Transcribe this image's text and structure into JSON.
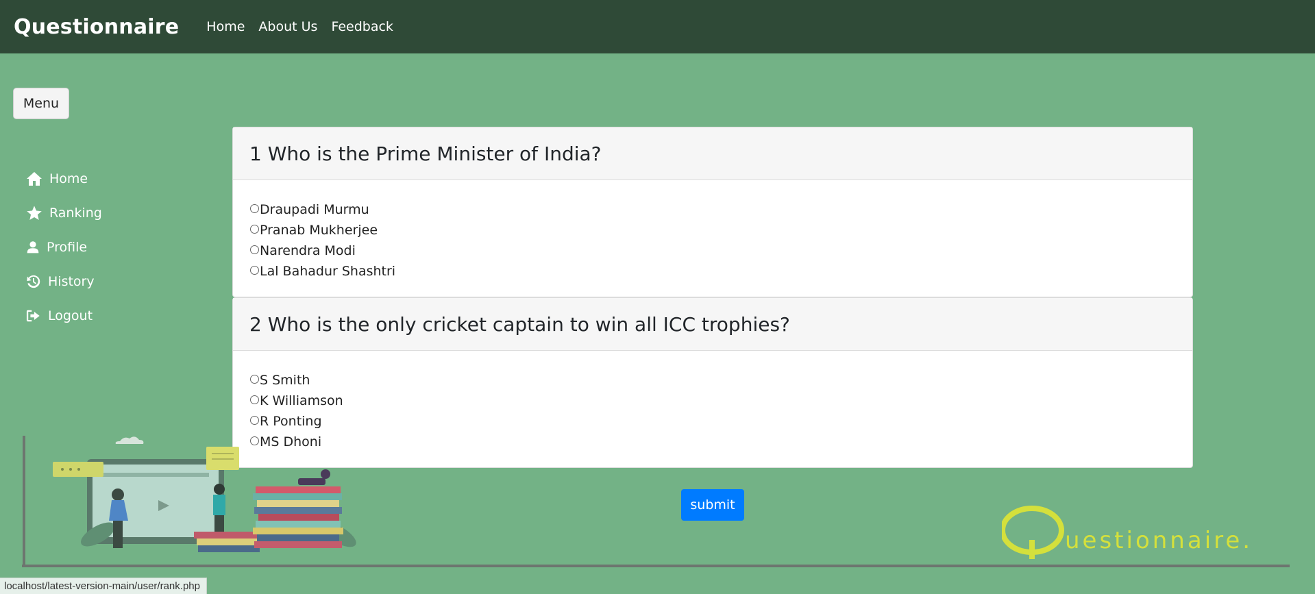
{
  "header": {
    "brand": "Questionnaire",
    "nav": [
      "Home",
      "About Us",
      "Feedback"
    ]
  },
  "menu_button": "Menu",
  "sidebar": {
    "items": [
      {
        "label": "Home",
        "icon": "home-icon"
      },
      {
        "label": "Ranking",
        "icon": "star-icon"
      },
      {
        "label": "Profile",
        "icon": "user-icon"
      },
      {
        "label": "History",
        "icon": "history-icon"
      },
      {
        "label": "Logout",
        "icon": "logout-icon"
      }
    ]
  },
  "questions": [
    {
      "title": "1 Who is the Prime Minister of India?",
      "options": [
        "Draupadi Murmu",
        "Pranab Mukherjee",
        "Narendra Modi",
        "Lal Bahadur Shashtri"
      ]
    },
    {
      "title": "2 Who is the only cricket captain to win all ICC trophies?",
      "options": [
        "S Smith",
        "K Williamson",
        "R Ponting",
        "MS Dhoni"
      ]
    }
  ],
  "submit_label": "submit",
  "logo": {
    "text": "uestionnaire."
  },
  "status_url": "localhost/latest-version-main/user/rank.php",
  "colors": {
    "background": "#73b286",
    "navbar": "#2f4a37",
    "submit": "#007bff",
    "logo": "#d4e03c"
  }
}
